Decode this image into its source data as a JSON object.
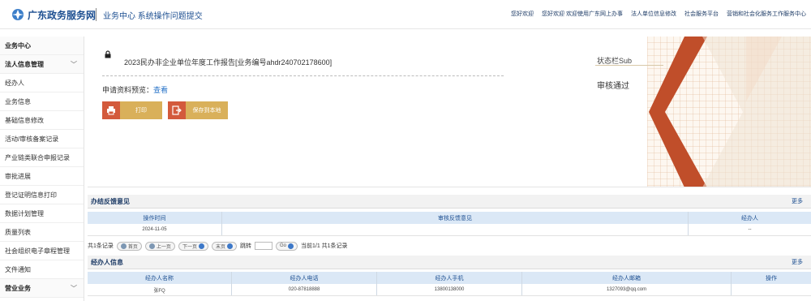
{
  "header": {
    "site_name": "广东政务服务网",
    "page_title": "业务中心  系统操作问题提交",
    "links": [
      "您好欢迎",
      "您好欢迎 欢迎使用广东网上办事",
      "法人单位信息修改",
      "社会服务平台",
      "营销和社会化服务工作服务中心"
    ]
  },
  "sidebar": {
    "items": [
      {
        "label": "业务中心",
        "head": true
      },
      {
        "label": "法人信息管理",
        "head": true,
        "chevron": "﹀"
      },
      {
        "label": "经办人"
      },
      {
        "label": "业务信息"
      },
      {
        "label": "基础信息修改"
      },
      {
        "label": "活动/审核备案记录"
      },
      {
        "label": "产业链类联合申报记录"
      },
      {
        "label": "审批进展"
      },
      {
        "label": "登记证明信息打印"
      },
      {
        "label": "数据计划管理"
      },
      {
        "label": "质量列表"
      },
      {
        "label": "社会组织电子章程管理"
      },
      {
        "label": "文件通知"
      },
      {
        "label": "营业业务",
        "head": true,
        "chevron": "﹀"
      }
    ]
  },
  "info": {
    "report_title": "2023民办非企业单位年度工作报告[业务编号ahdr240702178600]",
    "materials_label": "申请资料预览：",
    "materials_link": "查看",
    "print_label": "打印",
    "save_label": "保存到本地",
    "status_label": "状态栏Sub",
    "status_value": "审核通过"
  },
  "feedback": {
    "title": "办结反馈意见",
    "more": "更多",
    "columns": [
      "操作时间",
      "审核反馈意见",
      "经办人"
    ],
    "rows": [
      [
        "2024-11-05",
        "",
        "--"
      ]
    ]
  },
  "pager": {
    "total_label": "共1条记录",
    "first": "首页",
    "prev": "上一页",
    "next": "下一页",
    "last": "末页",
    "goto_label": "跳转",
    "go_btn": "Go",
    "page_info": "当前1/1 共1条记录"
  },
  "agent": {
    "title": "经办人信息",
    "more": "更多",
    "columns": [
      "经办人名称",
      "经办人电话",
      "经办人手机",
      "经办人邮箱",
      "操作"
    ],
    "rows": [
      [
        "张FQ",
        "020-87818888",
        "13800138000",
        "1327093@qq.com",
        ""
      ]
    ]
  }
}
